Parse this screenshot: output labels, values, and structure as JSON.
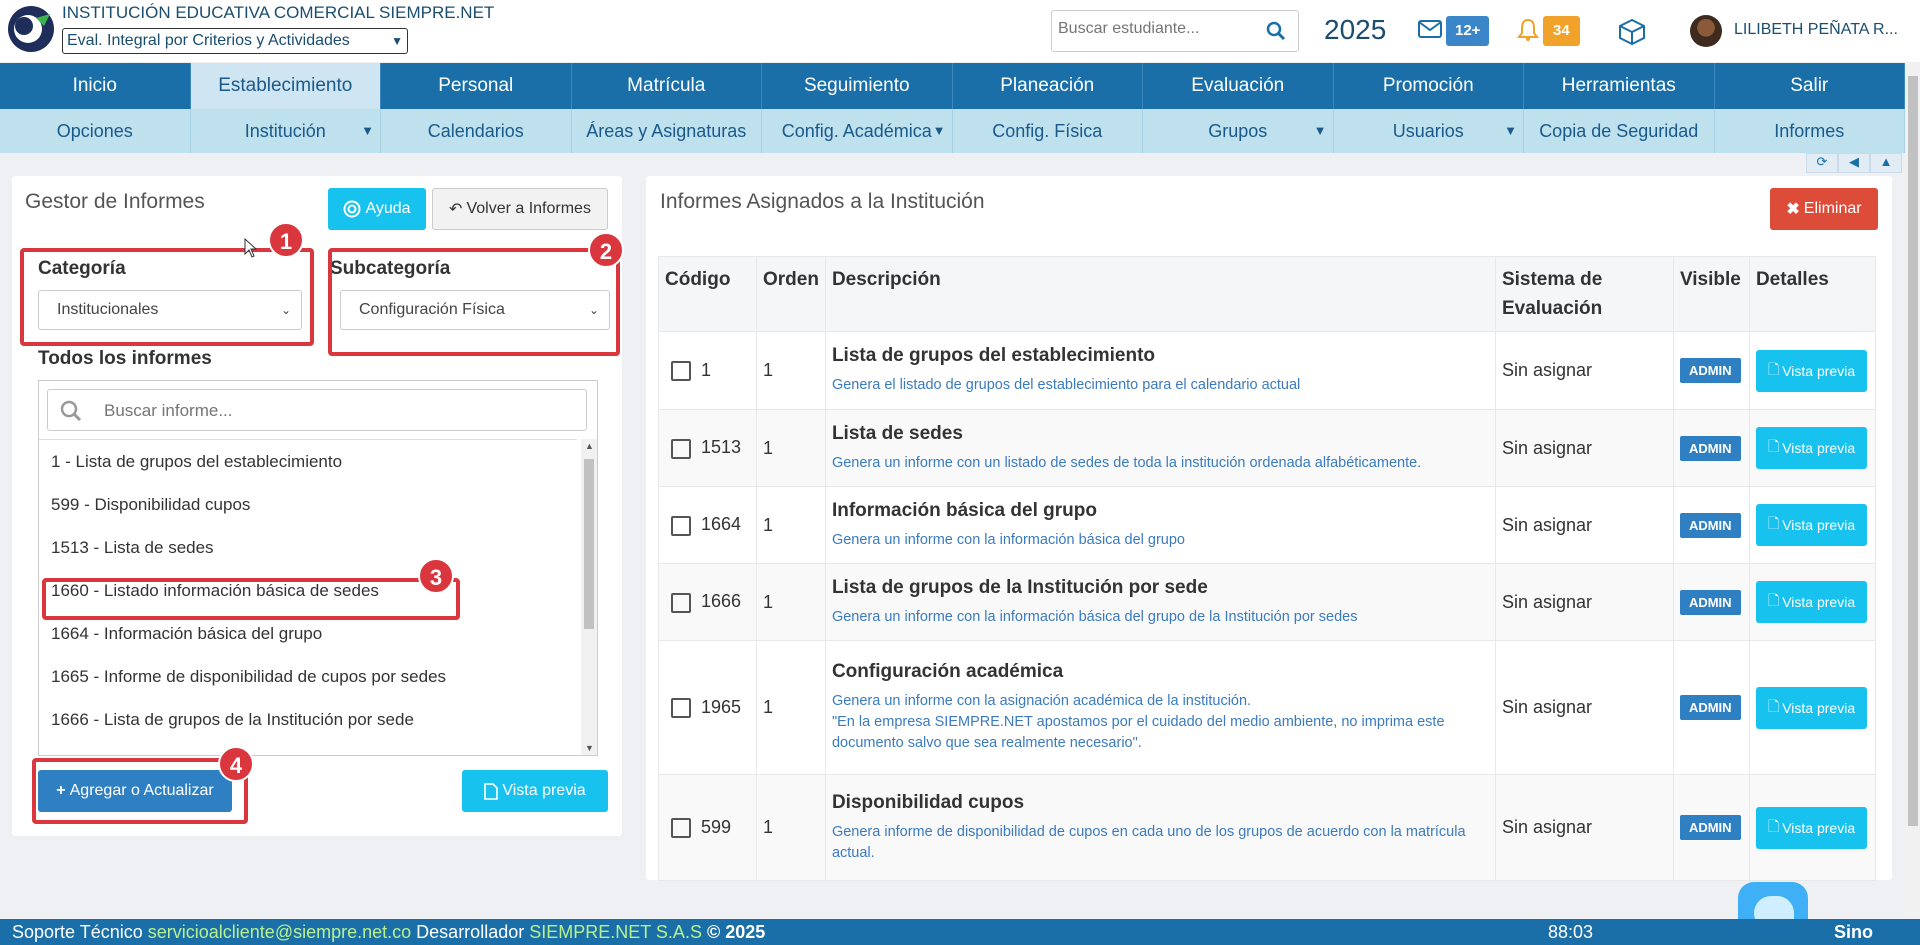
{
  "header": {
    "institution": "INSTITUCIÓN EDUCATIVA COMERCIAL SIEMPRE.NET",
    "eval_select": "Eval. Integral por Criterios y Actividades",
    "search_placeholder": "Buscar estudiante...",
    "year": "2025",
    "messages_badge": "12+",
    "notifications_badge": "34",
    "user": "LILIBETH PEÑATA R..."
  },
  "nav_main": [
    "Inicio",
    "Establecimiento",
    "Personal",
    "Matrícula",
    "Seguimiento",
    "Planeación",
    "Evaluación",
    "Promoción",
    "Herramientas",
    "Salir"
  ],
  "nav_sub": [
    {
      "label": "Opciones",
      "caret": ""
    },
    {
      "label": "Institución",
      "caret": "▼"
    },
    {
      "label": "Calendarios",
      "caret": ""
    },
    {
      "label": "Áreas y Asignaturas",
      "caret": ""
    },
    {
      "label": "Config. Académica",
      "caret": "▼"
    },
    {
      "label": "Config. Física",
      "caret": ""
    },
    {
      "label": "Grupos",
      "caret": "▼"
    },
    {
      "label": "Usuarios",
      "caret": "▼"
    },
    {
      "label": "Copia de Seguridad",
      "caret": ""
    },
    {
      "label": "Informes",
      "caret": ""
    }
  ],
  "left": {
    "title": "Gestor de Informes",
    "help_btn": "Ayuda",
    "back_btn": "Volver a Informes",
    "category_label": "Categoría",
    "category_value": "Institucionales",
    "subcategory_label": "Subcategoría",
    "subcategory_value": "Configuración Física",
    "all_reports_label": "Todos los informes",
    "search_placeholder": "Buscar informe...",
    "reports": [
      "1 - Lista de grupos del establecimiento",
      "599 - Disponibilidad cupos",
      "1513 - Lista de sedes",
      "1660 - Listado información básica de sedes",
      "1664 - Información básica del grupo",
      "1665 - Informe de disponibilidad de cupos por sedes",
      "1666 - Lista de grupos de la Institución por sede"
    ],
    "add_btn": "Agregar o Actualizar",
    "preview_btn": "Vista previa"
  },
  "markers": [
    "1",
    "2",
    "3",
    "4"
  ],
  "right": {
    "title": "Informes Asignados a la Institución",
    "delete_btn": "Eliminar",
    "columns": [
      "Código",
      "Orden",
      "Descripción",
      "Sistema de Evaluación",
      "Visible",
      "Detalles"
    ],
    "rows": [
      {
        "code": "1",
        "order": "1",
        "title": "Lista de grupos del establecimiento",
        "desc": "Genera el listado de grupos del establecimiento para el calendario actual",
        "system": "Sin asignar",
        "visible": "ADMIN",
        "details": "Vista previa"
      },
      {
        "code": "1513",
        "order": "1",
        "title": "Lista de sedes",
        "desc": "Genera un informe con un listado de sedes de toda la institución ordenada alfabéticamente.",
        "system": "Sin asignar",
        "visible": "ADMIN",
        "details": "Vista previa"
      },
      {
        "code": "1664",
        "order": "1",
        "title": "Información básica del grupo",
        "desc": "Genera un informe con la información básica del grupo",
        "system": "Sin asignar",
        "visible": "ADMIN",
        "details": "Vista previa"
      },
      {
        "code": "1666",
        "order": "1",
        "title": "Lista de grupos de la Institución por sede",
        "desc": "Genera un informe con la información básica del grupo de la Institución por sedes",
        "system": "Sin asignar",
        "visible": "ADMIN",
        "details": "Vista previa"
      },
      {
        "code": "1965",
        "order": "1",
        "title": "Configuración académica",
        "desc": "Genera un informe con la asignación académica de la institución.\n\"En la empresa SIEMPRE.NET apostamos por el cuidado del medio ambiente, no imprima este documento salvo que sea realmente necesario\".",
        "system": "Sin asignar",
        "visible": "ADMIN",
        "details": "Vista previa"
      },
      {
        "code": "599",
        "order": "1",
        "title": "Disponibilidad cupos",
        "desc": "Genera informe de disponibilidad de cupos en cada uno de los grupos de acuerdo con la matrícula actual.",
        "system": "Sin asignar",
        "visible": "ADMIN",
        "details": "Vista previa"
      }
    ]
  },
  "footer": {
    "support_label": "Soporte Técnico",
    "support_email": "servicioalcliente@siempre.net.co",
    "dev_label": "Desarrollador",
    "dev_name": "SIEMPRE.NET S.A.S",
    "copyright": "© 2025",
    "timer": "88:03",
    "brand": "Sino"
  },
  "colors": {
    "primary": "#1a6fa8",
    "subnav": "#bfe0ed",
    "info": "#18c2ee",
    "danger": "#dd4b39",
    "marker": "#d9363e"
  }
}
